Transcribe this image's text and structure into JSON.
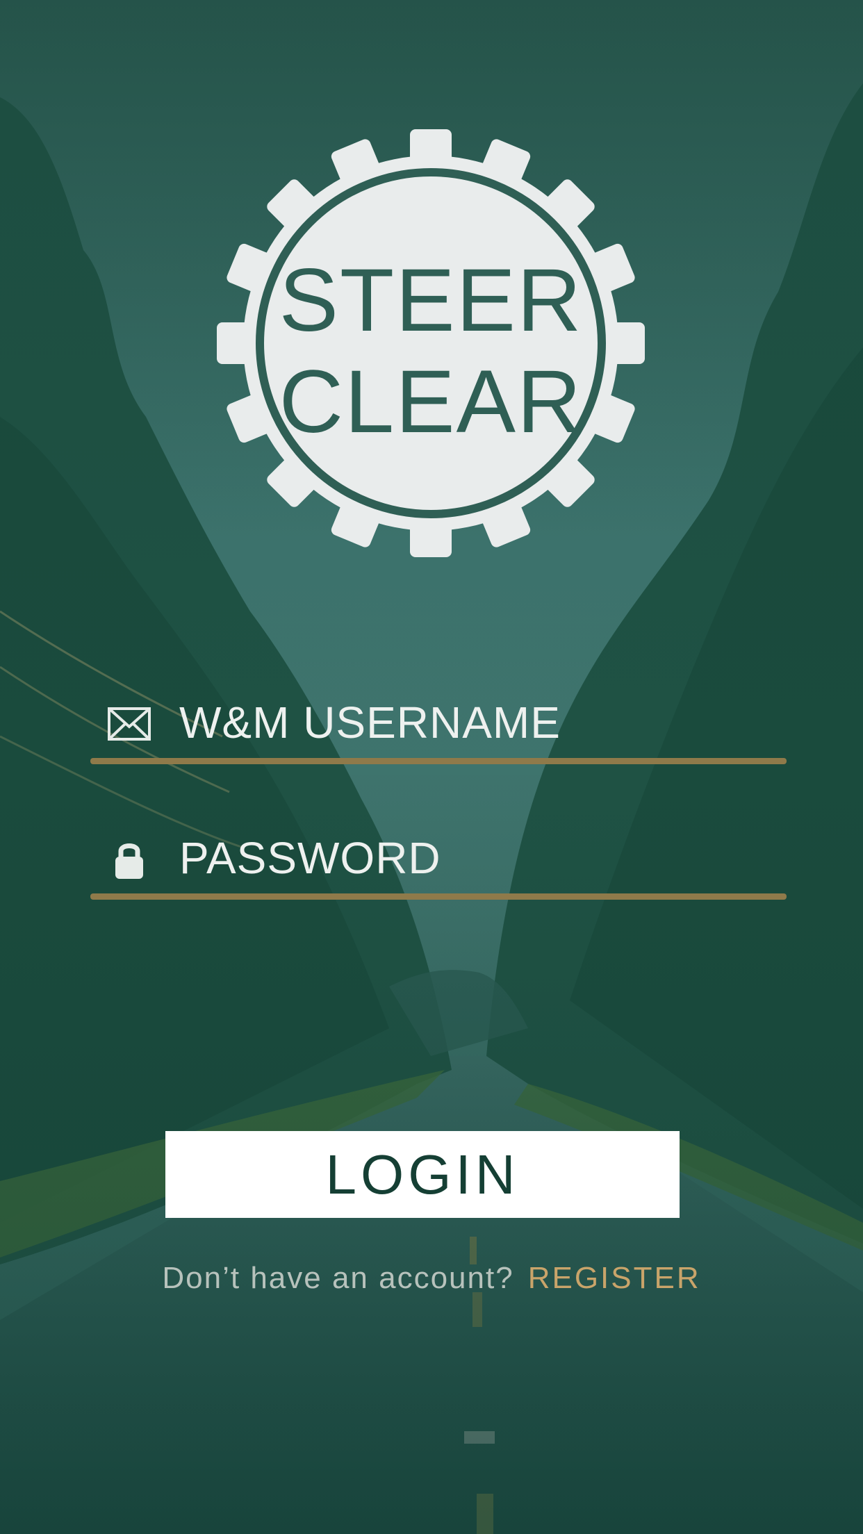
{
  "logo": {
    "line1": "STEER",
    "line2": "CLEAR"
  },
  "form": {
    "username": {
      "placeholder": "W&M USERNAME",
      "icon": "mail-icon"
    },
    "password": {
      "placeholder": "PASSWORD",
      "icon": "lock-icon"
    },
    "login_label": "LOGIN"
  },
  "register": {
    "prompt": "Don’t have an account?",
    "link": "REGISTER"
  },
  "colors": {
    "overlay": "#1f5a4c",
    "accent": "#c9a46a",
    "button_text": "#153f34",
    "logo_fill": "#e9ecec",
    "logo_ink": "#2f5f55"
  }
}
